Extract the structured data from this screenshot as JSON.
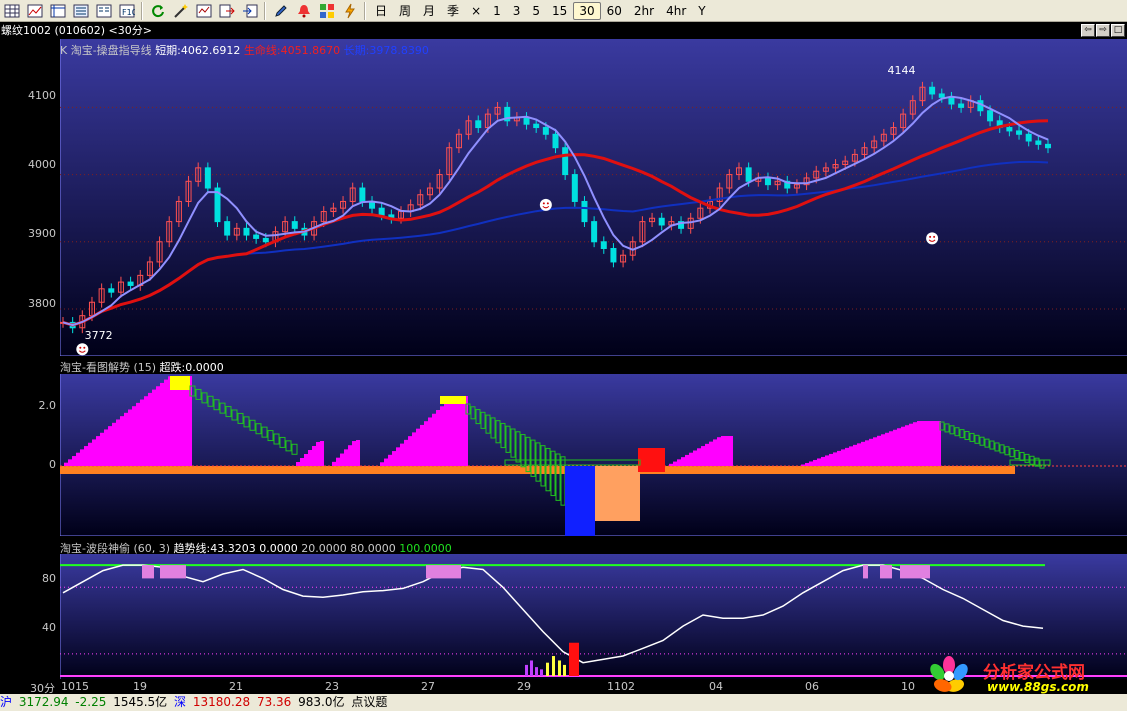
{
  "toolbar": {
    "icons": [
      "grid-icon",
      "line-chart-icon",
      "table-icon",
      "list-icon",
      "columns-icon",
      "f10-icon",
      "refresh-icon",
      "wand-icon",
      "formula-icon",
      "export-icon",
      "import-icon",
      "pen-icon",
      "alarm-icon",
      "blocks-icon",
      "lightning-icon"
    ],
    "periods": [
      "日",
      "周",
      "月",
      "季",
      "×",
      "1",
      "3",
      "5",
      "15",
      "30",
      "60",
      "2hr",
      "4hr",
      "Y"
    ],
    "active_period": "30"
  },
  "title": "螺纹1002 (010602) <30分>",
  "panel1": {
    "name": "K  淘宝-操盘指导线",
    "short_label": "短期:",
    "short_value": "4062.6912",
    "life_label": "生命线:",
    "life_value": "4051.8670",
    "long_label": "长期:",
    "long_value": "3978.8390",
    "high_mark": "4144",
    "low_mark": "3772",
    "y_ticks": [
      "4100",
      "4000",
      "3900",
      "3800"
    ]
  },
  "panel2": {
    "name": "淘宝-看图解势 (15)",
    "label": "超跌:",
    "value": "0.0000",
    "y_ticks": [
      "2.0",
      "0"
    ]
  },
  "panel3": {
    "name": "淘宝-波段神偷 (60, 3)",
    "trend_label": "趋势线:",
    "trend_value": "43.3203",
    "v1": "0.0000",
    "v2": "20.0000",
    "v3": "80.0000",
    "v4": "100.0000",
    "y_ticks": [
      "80",
      "40"
    ]
  },
  "xaxis": {
    "period": "30分",
    "labels": [
      "1015",
      "19",
      "21",
      "23",
      "27",
      "29",
      "1102",
      "04",
      "06",
      "10"
    ]
  },
  "status": {
    "sh_label": "沪",
    "sh_index": "3172.94",
    "sh_change": "-2.25",
    "sh_amount": "1545.5亿",
    "sz_label": "深",
    "sz_index": "13180.28",
    "sz_change": "73.36",
    "sz_amount": "983.0亿",
    "news": "点议题"
  },
  "watermark": {
    "text": "分析家公式网",
    "url": "www.88gs.com"
  },
  "colors": {
    "bg_top": "#3a3aa0",
    "bg_bottom": "#000018",
    "short": "#ffff40",
    "life": "#e01010",
    "long": "#1030c0",
    "magenta": "#ff00ff",
    "green": "#20c020"
  },
  "chart_data": [
    {
      "type": "candlestick",
      "title": "淘宝-操盘指导线",
      "y_ticks": [
        4100,
        4000,
        3900,
        3800
      ],
      "ylim": [
        3730,
        4175
      ],
      "series": [
        {
          "name": "短期",
          "last": 4062.6912
        },
        {
          "name": "生命线",
          "last": 4051.867
        },
        {
          "name": "长期",
          "last": 3978.839
        }
      ],
      "close": [
        3780,
        3772,
        3790,
        3810,
        3830,
        3825,
        3840,
        3835,
        3850,
        3870,
        3900,
        3930,
        3960,
        3990,
        4010,
        3980,
        3930,
        3910,
        3920,
        3910,
        3905,
        3900,
        3915,
        3930,
        3920,
        3910,
        3930,
        3945,
        3950,
        3960,
        3980,
        3960,
        3950,
        3940,
        3935,
        3945,
        3955,
        3970,
        3980,
        4000,
        4040,
        4060,
        4080,
        4070,
        4090,
        4100,
        4080,
        4085,
        4075,
        4070,
        4060,
        4040,
        4000,
        3960,
        3930,
        3900,
        3890,
        3870,
        3880,
        3900,
        3930,
        3935,
        3925,
        3930,
        3920,
        3935,
        3950,
        3960,
        3980,
        4000,
        4010,
        3990,
        3995,
        3985,
        3990,
        3980,
        3985,
        3995,
        4005,
        4010,
        4015,
        4020,
        4030,
        4040,
        4050,
        4060,
        4070,
        4090,
        4110,
        4130,
        4120,
        4115,
        4105,
        4100,
        4110,
        4095,
        4080,
        4070,
        4065,
        4060,
        4050,
        4045,
        4040
      ]
    },
    {
      "type": "bar",
      "title": "淘宝-看图解势 (15)",
      "y_ticks": [
        2.0,
        0
      ],
      "ylim": [
        -1.0,
        3.0
      ],
      "series": [
        {
          "name": "超跌",
          "last": 0.0
        }
      ]
    },
    {
      "type": "line",
      "title": "淘宝-波段神偷 (60, 3)",
      "y_ticks": [
        80,
        40
      ],
      "ylim": [
        0,
        110
      ],
      "series": [
        {
          "name": "趋势线",
          "last": 43.3203
        }
      ],
      "levels": [
        0,
        20,
        80,
        100
      ],
      "values": [
        75,
        85,
        95,
        100,
        100,
        98,
        90,
        85,
        92,
        96,
        88,
        78,
        72,
        71,
        73,
        76,
        77,
        79,
        85,
        94,
        98,
        96,
        80,
        60,
        40,
        22,
        12,
        15,
        18,
        25,
        32,
        45,
        55,
        52,
        52,
        55,
        63,
        75,
        85,
        95,
        100,
        100,
        95,
        88,
        78,
        70,
        60,
        50,
        45,
        43
      ]
    }
  ]
}
